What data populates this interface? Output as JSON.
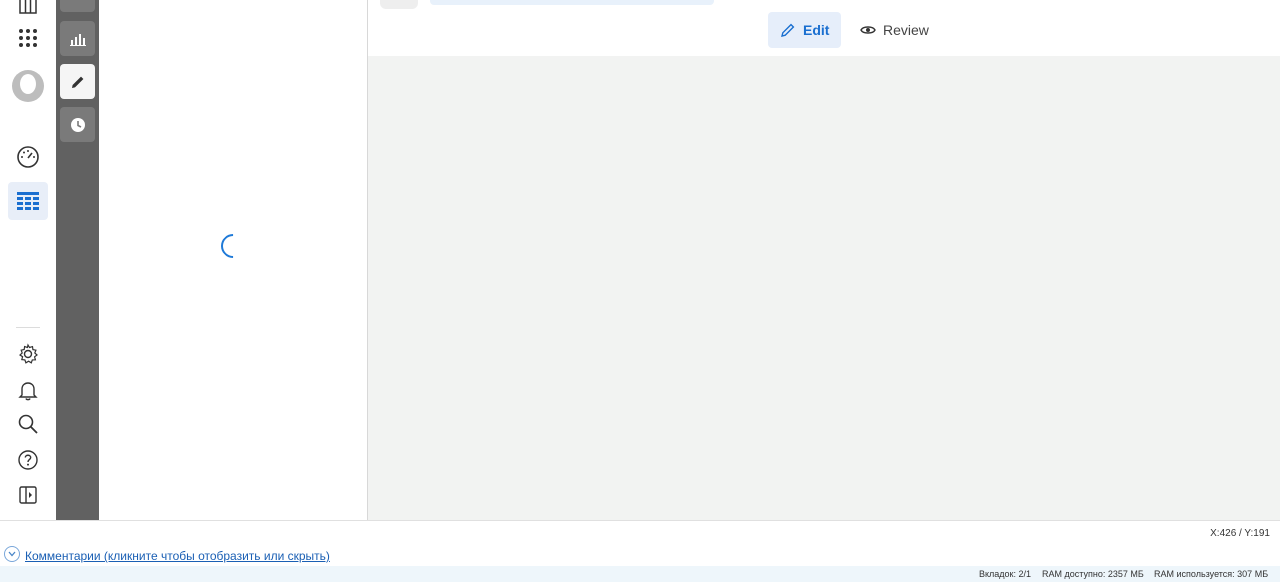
{
  "toolbar": {
    "edit_label": "Edit",
    "review_label": "Review"
  },
  "cursor": {
    "coords": "X:426 / Y:191"
  },
  "comments": {
    "toggle_label": "Комментарии (кликните чтобы отобразить или скрыть)"
  },
  "status": {
    "tabs": "Вкладок: 2/1",
    "ram_free": "RAM доступно: 2357 МБ",
    "ram_used": "RAM используется: 307 МБ"
  },
  "colors": {
    "accent": "#1a6fd0",
    "strip": "#616161",
    "main_bg": "#f2f3f2"
  },
  "icons": {
    "rail": [
      "layout-icon",
      "apps-grid-icon",
      "avatar-icon",
      "dashboard-gauge-icon",
      "table-icon",
      "settings-gear-icon",
      "bell-icon",
      "search-icon",
      "help-icon",
      "panel-toggle-icon"
    ],
    "strip": [
      "bar-chart-icon",
      "pencil-icon",
      "clock-icon"
    ]
  }
}
